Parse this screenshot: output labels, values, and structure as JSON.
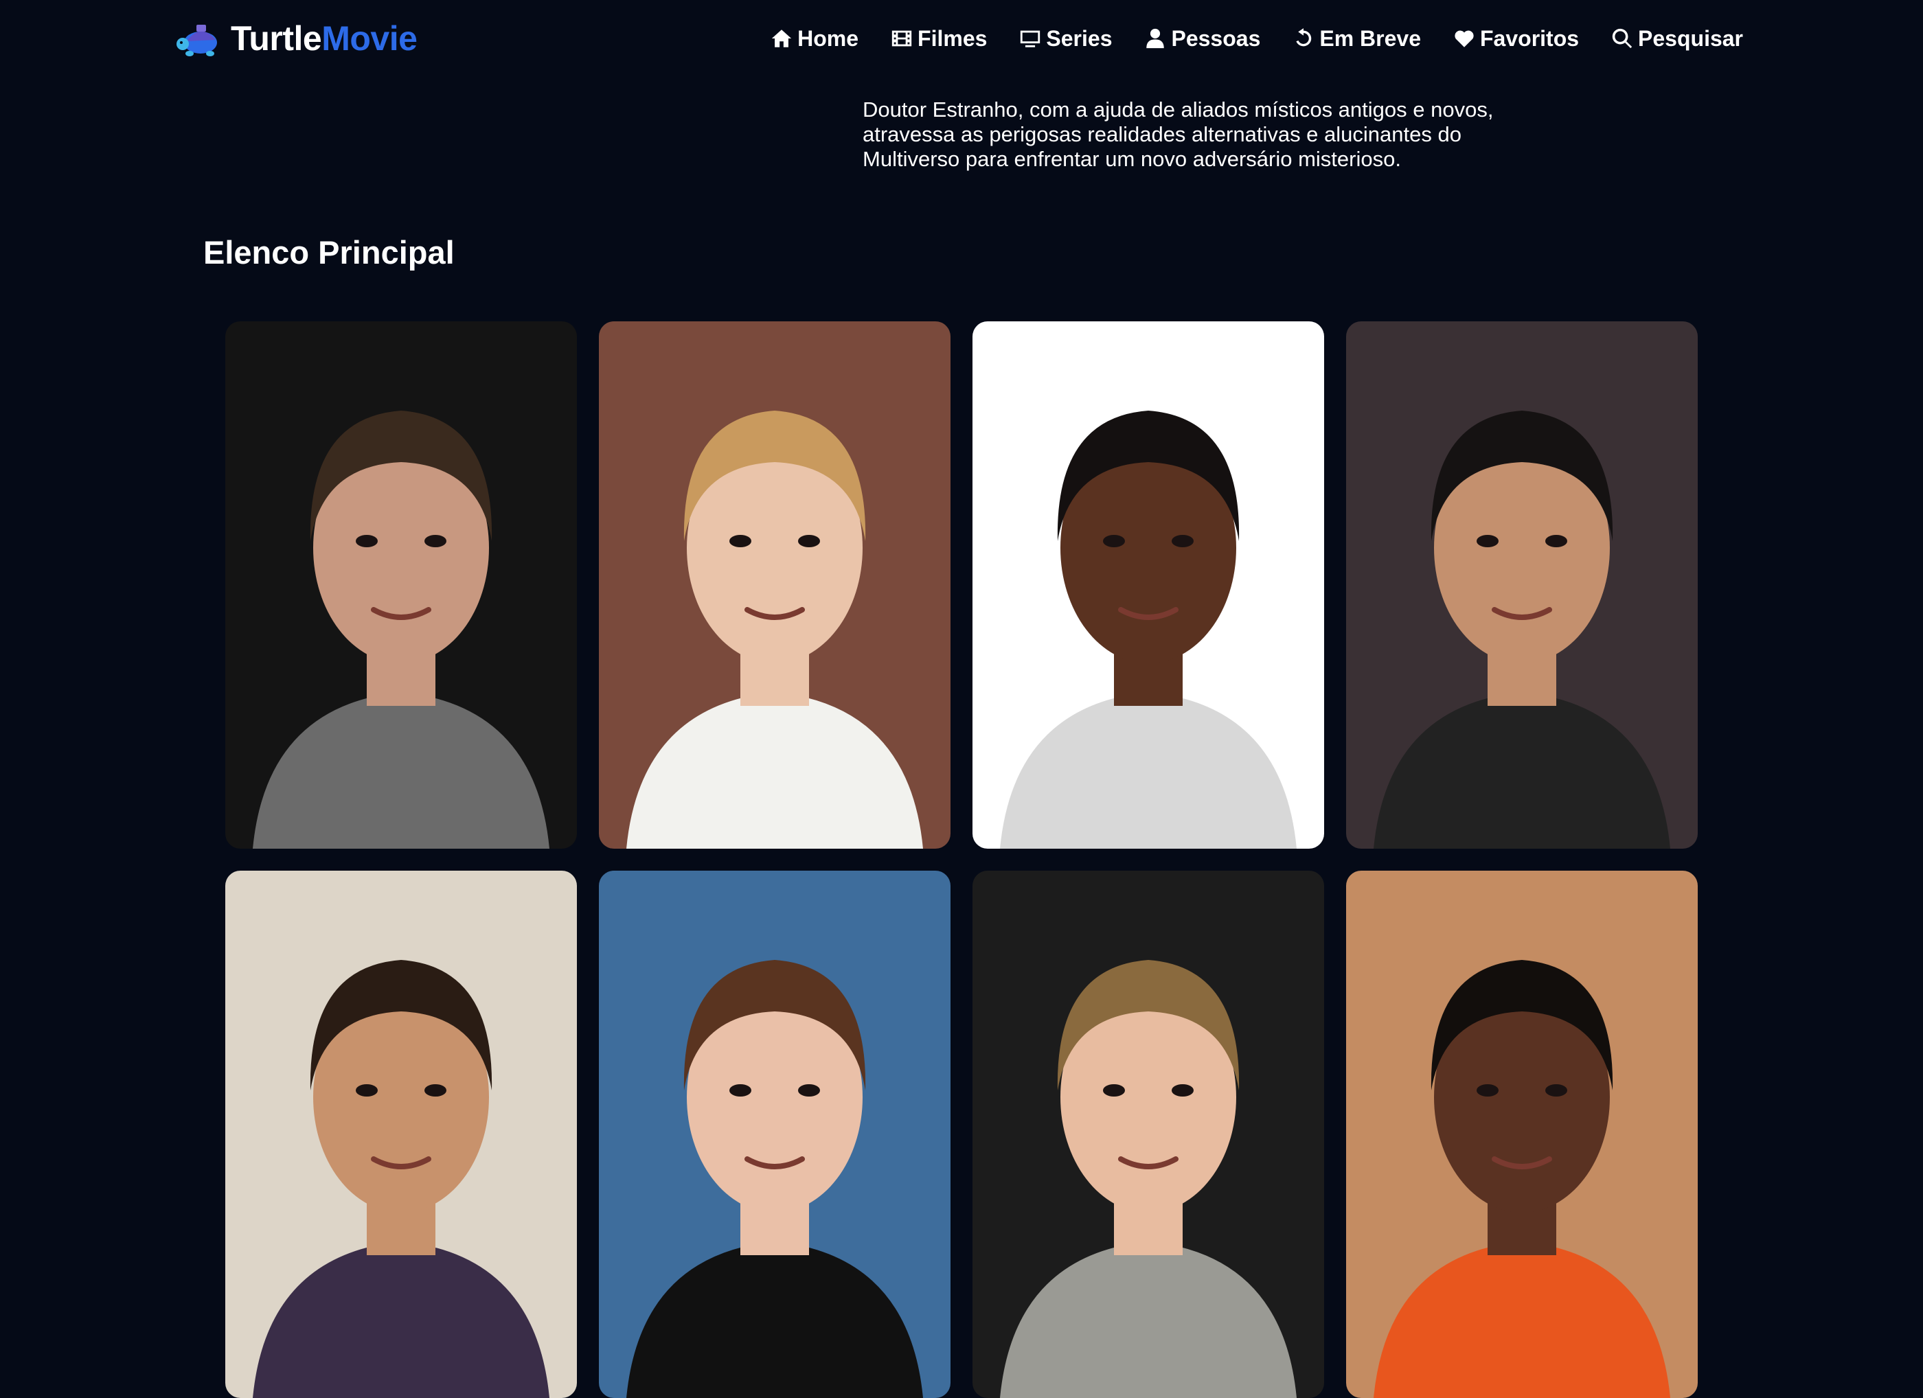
{
  "app": {
    "logo_part1": "Turtle",
    "logo_part2": "Movie",
    "colors": {
      "background": "#050a17",
      "brand_accent": "#2d6be8",
      "text": "#ffffff"
    }
  },
  "nav": {
    "items": [
      {
        "label": "Home",
        "icon": "home-icon"
      },
      {
        "label": "Filmes",
        "icon": "film-icon"
      },
      {
        "label": "Series",
        "icon": "tv-icon"
      },
      {
        "label": "Pessoas",
        "icon": "person-icon"
      },
      {
        "label": "Em Breve",
        "icon": "undo-icon"
      },
      {
        "label": "Favoritos",
        "icon": "heart-icon"
      },
      {
        "label": "Pesquisar",
        "icon": "search-icon"
      }
    ]
  },
  "movie": {
    "overview": "Doutor Estranho, com a ajuda de aliados místicos antigos e novos, atravessa as perigosas realidades alternativas e alucinantes do Multiverso para enfrentar um novo adversário misterioso."
  },
  "cast_section": {
    "title": "Elenco Principal",
    "cards": [
      {
        "photo": "cast-photo-1",
        "bg": "#141414",
        "skin": "#c89880",
        "hair": "#3a2a1e",
        "shirt": "#6b6b6b"
      },
      {
        "photo": "cast-photo-2",
        "bg": "#7a4a3c",
        "skin": "#eac4aa",
        "hair": "#c99a5e",
        "shirt": "#f2f2ee"
      },
      {
        "photo": "cast-photo-3",
        "bg": "#ffffff",
        "skin": "#5a3220",
        "hair": "#141010",
        "shirt": "#d8d8d8"
      },
      {
        "photo": "cast-photo-4",
        "bg": "#3a3034",
        "skin": "#c4906e",
        "hair": "#151212",
        "shirt": "#222222"
      },
      {
        "photo": "cast-photo-5",
        "bg": "#ddd5c8",
        "skin": "#c8926c",
        "hair": "#2a1c14",
        "shirt": "#3a2d48"
      },
      {
        "photo": "cast-photo-6",
        "bg": "#3e6d9c",
        "skin": "#eac0a8",
        "hair": "#5a3420",
        "shirt": "#111111"
      },
      {
        "photo": "cast-photo-7",
        "bg": "#1c1c1c",
        "skin": "#e8bca0",
        "hair": "#8a6a3e",
        "shirt": "#9a9a94"
      },
      {
        "photo": "cast-photo-8",
        "bg": "#c48c62",
        "skin": "#5a3222",
        "hair": "#120e0c",
        "shirt": "#e8561e"
      }
    ]
  }
}
